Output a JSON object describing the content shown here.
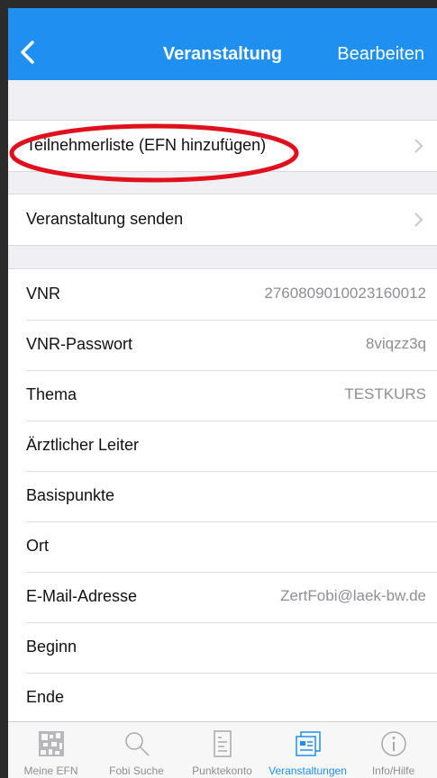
{
  "colors": {
    "accent": "#1f8ff0",
    "highlight": "#e0101d"
  },
  "nav": {
    "title": "Veranstaltung",
    "edit": "Bearbeiten"
  },
  "actions": [
    {
      "label": "Teilnehmerliste (EFN hinzufügen)"
    },
    {
      "label": "Veranstaltung senden"
    }
  ],
  "details": [
    {
      "label": "VNR",
      "value": "2760809010023160012"
    },
    {
      "label": "VNR-Passwort",
      "value": "8viqzz3q"
    },
    {
      "label": "Thema",
      "value": "TESTKURS"
    },
    {
      "label": "Ärztlicher Leiter",
      "value": ""
    },
    {
      "label": "Basispunkte",
      "value": ""
    },
    {
      "label": "Ort",
      "value": ""
    },
    {
      "label": "E-Mail-Adresse",
      "value": "ZertFobi@laek-bw.de"
    },
    {
      "label": "Beginn",
      "value": ""
    },
    {
      "label": "Ende",
      "value": ""
    }
  ],
  "tabs": [
    {
      "label": "Meine EFN",
      "icon": "barcode-icon"
    },
    {
      "label": "Fobi Suche",
      "icon": "search-icon"
    },
    {
      "label": "Punktekonto",
      "icon": "document-icon"
    },
    {
      "label": "Veranstaltungen",
      "icon": "event-list-icon",
      "active": true
    },
    {
      "label": "Info/Hilfe",
      "icon": "info-icon"
    }
  ]
}
